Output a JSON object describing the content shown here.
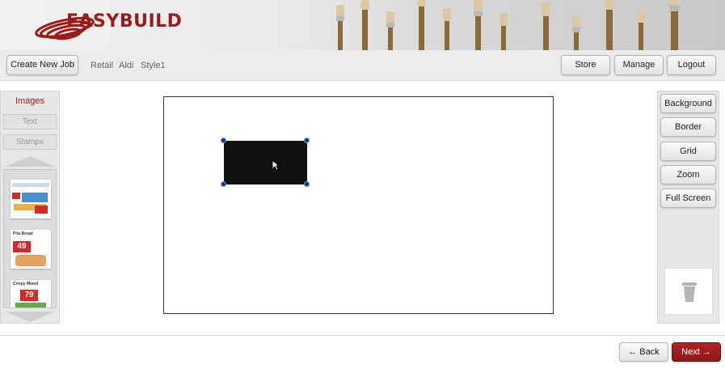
{
  "brand": {
    "name": "EASYBUILD",
    "color": "#9b1b1b"
  },
  "toolbar": {
    "create_label": "Create New Job",
    "breadcrumbs": [
      "Retail",
      "Aldi",
      "Style1"
    ],
    "store_label": "Store",
    "manage_label": "Manage",
    "logout_label": "Logout"
  },
  "left_panel": {
    "tabs": [
      {
        "label": "Images",
        "active": true
      },
      {
        "label": "Text",
        "active": false
      },
      {
        "label": "Stamps",
        "active": false
      }
    ],
    "thumbnails": [
      {
        "name": "flyer-thumbnail-1",
        "price": ""
      },
      {
        "name": "flyer-thumbnail-pita-bread",
        "title": "Pita Bread",
        "price": "49"
      },
      {
        "name": "flyer-thumbnail-crispy-mixed",
        "title": "Crispy Mixed",
        "price": "79"
      }
    ]
  },
  "right_panel": {
    "buttons": [
      "Background",
      "Border",
      "Grid",
      "Zoom",
      "Full Screen"
    ]
  },
  "footer": {
    "back_label": "← Back",
    "next_label": "Next →"
  },
  "colors": {
    "accent": "#9b1b1b",
    "next_button": "#a11d1d",
    "canvas_shape": "#111111"
  }
}
